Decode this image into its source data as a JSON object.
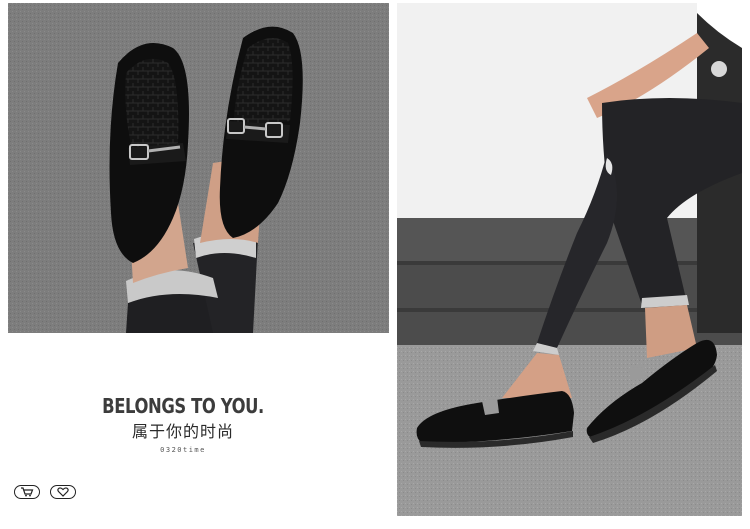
{
  "tagline": {
    "title": "BELONGS TO YOU.",
    "subtitle": "属于你的时尚",
    "code": "0320time"
  },
  "icons": {
    "cart": "cart-icon",
    "heart": "heart-icon"
  },
  "colors": {
    "carpet": "#7a7a7a",
    "shoe": "#111111",
    "wall": "#f2f2f2",
    "sofa": "#4a4a4a",
    "floor": "#9a9a9a"
  }
}
